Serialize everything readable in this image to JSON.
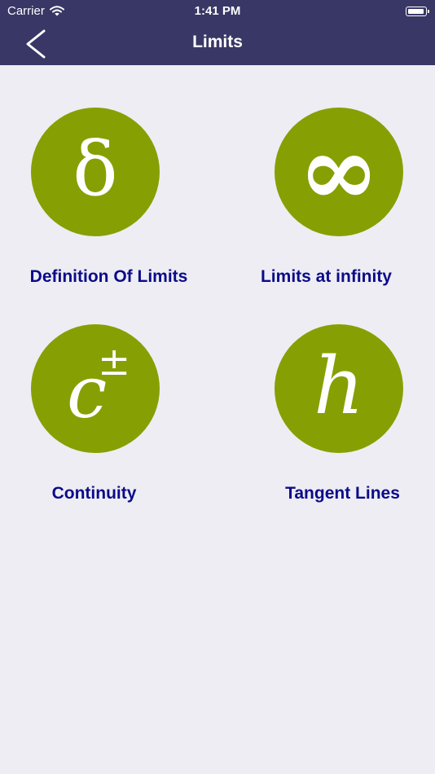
{
  "status_bar": {
    "carrier": "Carrier",
    "time": "1:41 PM"
  },
  "nav": {
    "title": "Limits",
    "back_icon": "chevron-left-icon"
  },
  "topics": [
    {
      "label": "Definition Of Limits",
      "symbol": "δ",
      "icon": "delta-symbol-icon"
    },
    {
      "label": "Limits at infinity",
      "symbol": "∞",
      "icon": "infinity-symbol-icon"
    },
    {
      "label": "Continuity",
      "symbol": "c",
      "superscript": "±",
      "icon": "c-plus-minus-symbol-icon"
    },
    {
      "label": "Tangent Lines",
      "symbol": "h",
      "icon": "h-symbol-icon"
    }
  ],
  "colors": {
    "header": "#383766",
    "background": "#EEEDF3",
    "circle": "#86A003",
    "label": "#0B0B8A"
  }
}
